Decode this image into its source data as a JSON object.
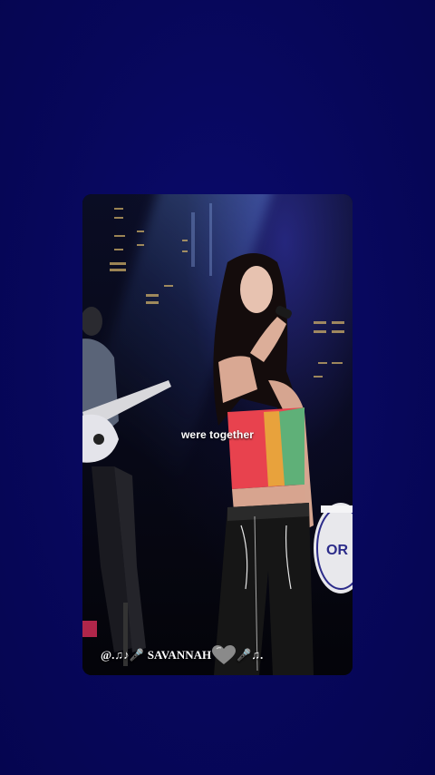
{
  "video": {
    "caption": "were together",
    "watermark_prefix": "@.♫♪🎤",
    "watermark_name": "SAVANNAH",
    "watermark_suffix": "🎤♫.",
    "watermark_heart_icon": "grey-heart-icon"
  },
  "colors": {
    "background": "#07075a",
    "caption_text": "#ffffff"
  }
}
